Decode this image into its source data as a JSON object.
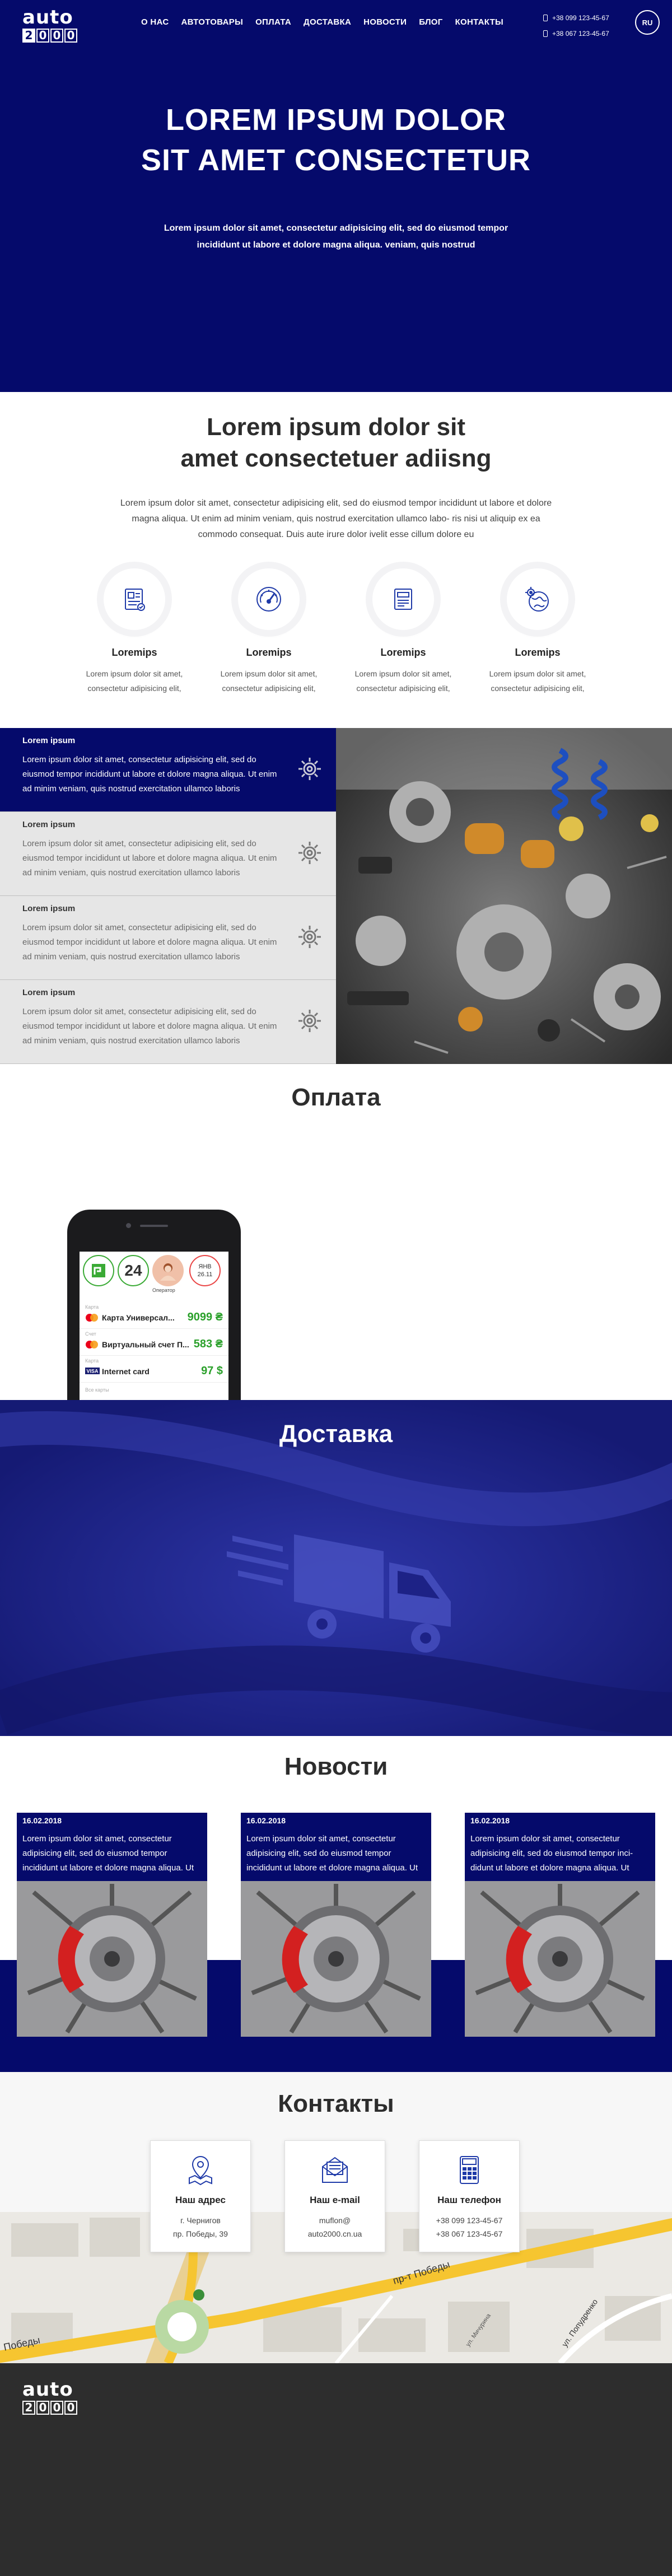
{
  "brand": {
    "word": "auto",
    "digits": [
      "2",
      "0",
      "0",
      "0"
    ]
  },
  "nav": [
    "О НАС",
    "АВТОТОВАРЫ",
    "ОПЛАТА",
    "ДОСТАВКА",
    "НОВОСТИ",
    "БЛОГ",
    "КОНТАКТЫ"
  ],
  "phones": [
    "+38 099 123-45-67",
    "+38 067 123-45-67"
  ],
  "lang": "RU",
  "hero": {
    "title_line1": "LOREM IPSUM DOLOR",
    "title_line2": "SIT AMET CONSECTETUR",
    "text": "Lorem ipsum dolor sit amet, consectetur adipisicing elit, sed do eiusmod tempor incididunt ut labore et dolore magna aliqua. veniam, quis nostrud"
  },
  "intro": {
    "title_line1": "Lorem ipsum dolor sit",
    "title_line2": "amet consectetuer adiisng",
    "text": "Lorem ipsum dolor sit amet, consectetur adipisicing elit, sed do eiusmod tempor incididunt ut labore et dolore magna aliqua. Ut enim ad minim veniam, quis nostrud exercitation ullamco labo- ris nisi ut aliquip ex ea commodo consequat. Duis aute irure dolor ivelit esse cillum dolore eu"
  },
  "features": [
    {
      "title": "Loremips",
      "text": "Lorem ipsum dolor sit amet, consectetur adipisicing elit,",
      "icon": "catalog-icon"
    },
    {
      "title": "Loremips",
      "text": "Lorem ipsum dolor sit amet, consectetur adipisicing elit,",
      "icon": "speedometer-icon"
    },
    {
      "title": "Loremips",
      "text": "Lorem ipsum dolor sit amet, consectetur adipisicing elit,",
      "icon": "document-icon"
    },
    {
      "title": "Loremips",
      "text": "Lorem ipsum dolor sit amet, consectetur adipisicing elit,",
      "icon": "globe-gear-icon"
    }
  ],
  "accordion": [
    {
      "title": "Lorem ipsum",
      "text": "Lorem ipsum dolor sit amet, consectetur adipisicing elit, sed do eiusmod tempor incididunt ut labore et dolore magna aliqua. Ut enim ad minim veniam, quis nostrud exercitation ullamco laboris",
      "active": true
    },
    {
      "title": "Lorem ipsum",
      "text": "Lorem ipsum dolor sit amet, consectetur adipisicing elit, sed do eiusmod tempor incididunt ut labore et dolore magna aliqua. Ut enim ad minim veniam, quis nostrud exercitation ullamco laboris",
      "active": false
    },
    {
      "title": "Lorem ipsum",
      "text": "Lorem ipsum dolor sit amet, consectetur adipisicing elit, sed do eiusmod tempor incididunt ut labore et dolore magna aliqua. Ut enim ad minim veniam, quis nostrud exercitation ullamco laboris",
      "active": false
    },
    {
      "title": "Lorem ipsum",
      "text": "Lorem ipsum dolor sit amet, consectetur adipisicing elit, sed do eiusmod tempor incididunt ut labore et dolore magna aliqua. Ut enim ad minim veniam, quis nostrud exercitation ullamco laboris",
      "active": false
    }
  ],
  "payment": {
    "title": "Оплата",
    "tile_number": "24",
    "tile_date_top": "ЯНВ",
    "tile_date_bottom": "26.11",
    "operator_label": "Оператор",
    "cards": [
      {
        "small": "Карта",
        "name": "Карта Универсал...",
        "value": "9099 ₴",
        "icon": "mastercard-icon"
      },
      {
        "small": "Счет",
        "name": "Виртуальный счет П...",
        "value": "583 ₴",
        "icon": "mastercard-icon"
      },
      {
        "small": "Карта",
        "name": "Internet card",
        "value": "97 $",
        "icon": "visa-icon"
      }
    ],
    "more": "Все карты"
  },
  "delivery": {
    "title": "Доставка"
  },
  "news": {
    "title": "Новости",
    "items": [
      {
        "date": "16.02.2018",
        "text": "Lorem ipsum dolor sit amet, consectetur adipisicing elit, sed do eiusmod tempor incididunt ut labore et dolore magna aliqua. Ut"
      },
      {
        "date": "16.02.2018",
        "text": "Lorem ipsum dolor sit amet, consectetur adipisicing elit, sed do eiusmod tempor incididunt ut labore et dolore magna aliqua. Ut"
      },
      {
        "date": "16.02.2018",
        "text": "Lorem ipsum dolor sit amet, consectetur adipisicing elit, sed do eiusmod tempor inci- didunt ut labore et dolore magna aliqua. Ut"
      }
    ]
  },
  "contacts": {
    "title": "Контакты",
    "cards": [
      {
        "title": "Наш адрес",
        "line1": "г. Чернигов",
        "line2": "пр. Победы, 39",
        "icon": "map-pin-icon"
      },
      {
        "title": "Наш e-mail",
        "line1": "muflon@",
        "line2": "auto2000.cn.ua",
        "icon": "envelope-icon"
      },
      {
        "title": "Наш телефон",
        "line1": "+38 099 123-45-67",
        "line2": "+38 067 123-45-67",
        "icon": "phone-icon"
      }
    ],
    "map_labels": [
      "пр-т Победы",
      "Победы",
      "ул. Попудренко",
      "ул. Мичурина"
    ]
  },
  "colors": {
    "primary": "#050a6b",
    "delivery_bg": "#1d2286",
    "footer_bg": "#2d2d2d",
    "accent_green": "#2aa02a"
  }
}
